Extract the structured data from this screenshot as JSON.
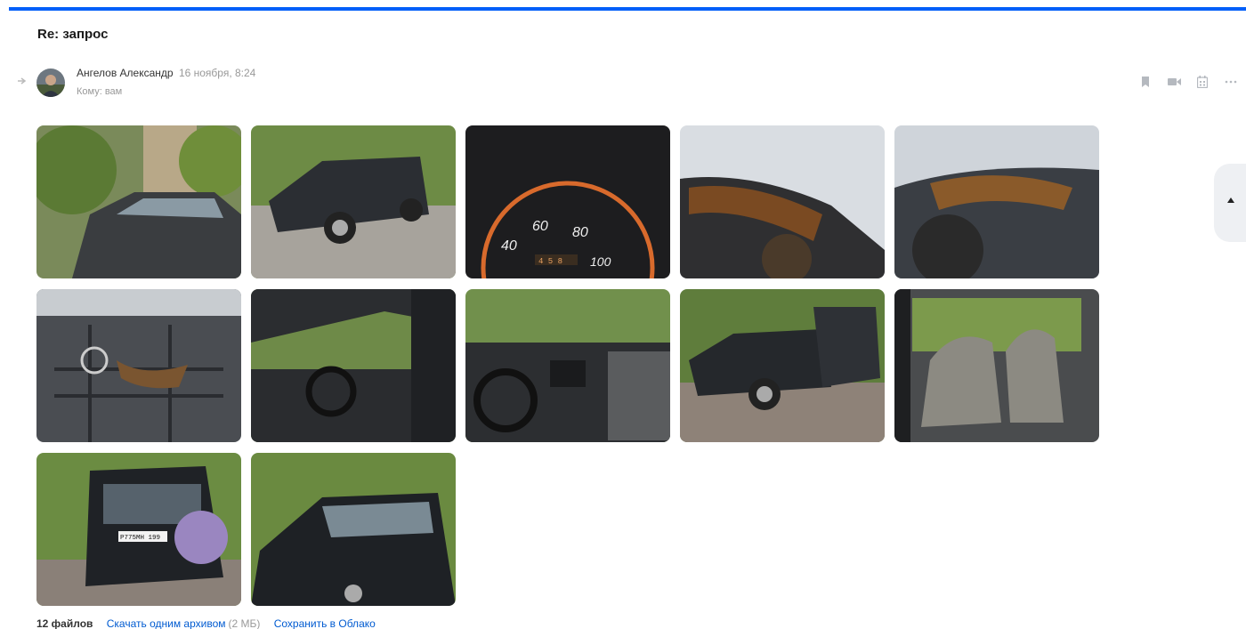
{
  "message": {
    "subject": "Re: запрос",
    "sender_name": "Ангелов Александр",
    "date": "16 ноября, 8:24",
    "recipient": "Кому: вам"
  },
  "actions": [
    "bookmark-icon",
    "video-icon",
    "calendar-icon",
    "more-icon"
  ],
  "attachments": {
    "count_label": "12 файлов",
    "download_all_label": "Скачать одним архивом",
    "download_size": "(2 МБ)",
    "save_cloud_label": "Сохранить в Облако",
    "plate_text": "Р775МН 199",
    "speedo_ticks": [
      "40",
      "60",
      "80",
      "100"
    ],
    "odometer": "4 5 8"
  },
  "colors": {
    "accent": "#005ff9",
    "link": "#005bd1",
    "muted": "#999999"
  }
}
